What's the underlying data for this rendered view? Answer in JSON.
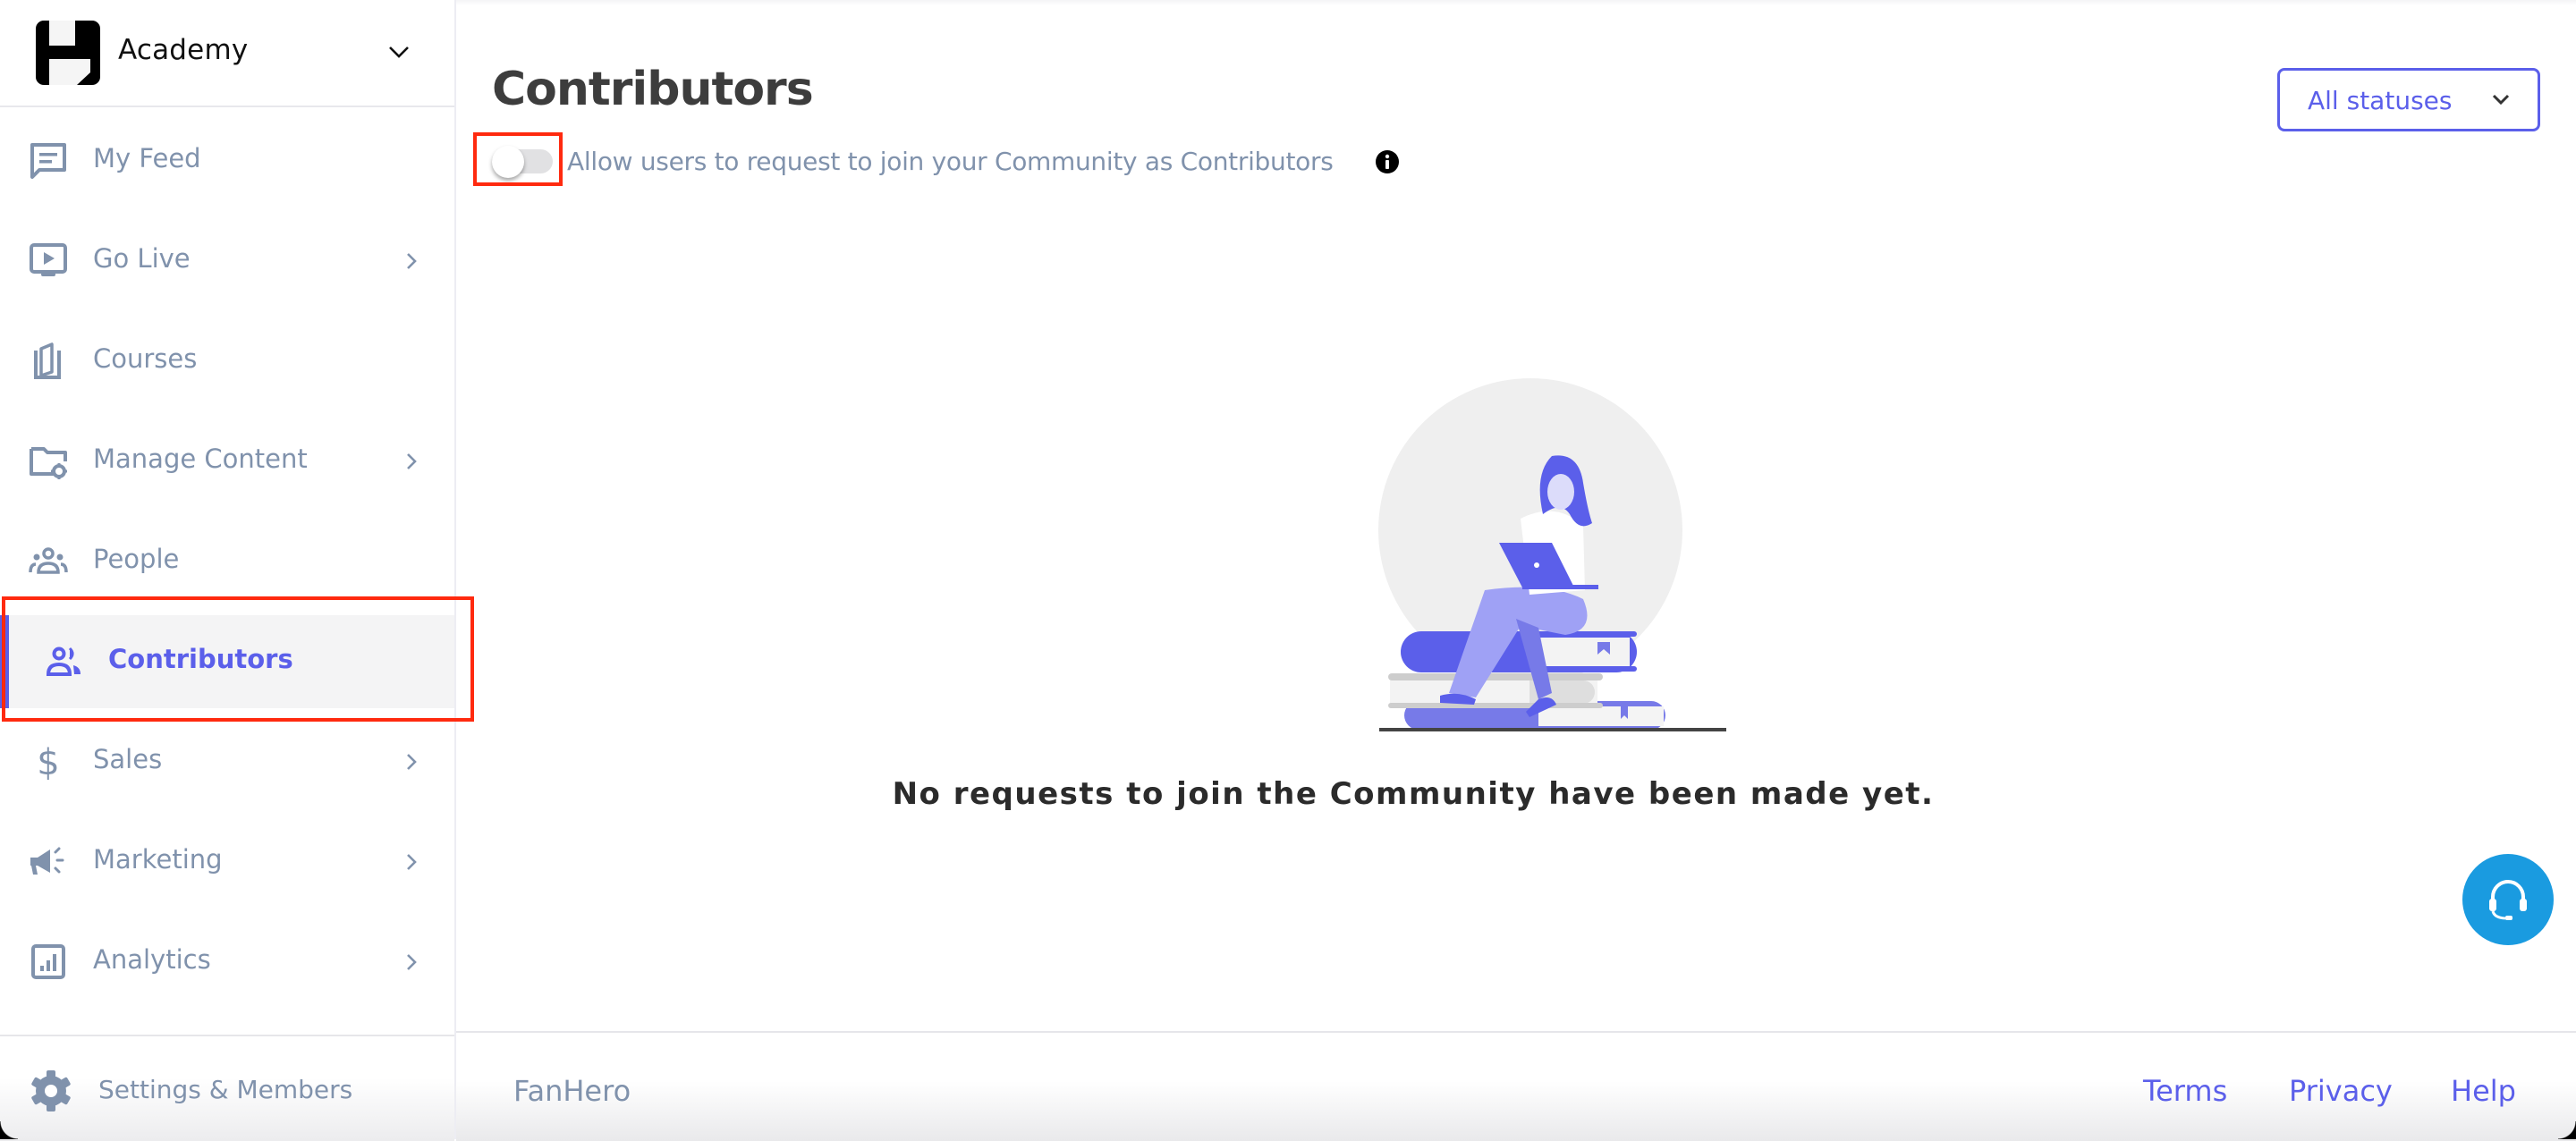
{
  "app": {
    "brand_name": "Academy",
    "logo": "fanhero-logo",
    "brand_dropdown_icon": "chevron-down-icon"
  },
  "sidebar": {
    "items": [
      {
        "label": "My Feed",
        "icon": "feed-icon",
        "has_submenu": false,
        "active": false
      },
      {
        "label": "Go Live",
        "icon": "live-video-icon",
        "has_submenu": true,
        "active": false
      },
      {
        "label": "Courses",
        "icon": "book-icon",
        "has_submenu": false,
        "active": false
      },
      {
        "label": "Manage Content",
        "icon": "folder-settings-icon",
        "has_submenu": true,
        "active": false
      },
      {
        "label": "People",
        "icon": "people-icon",
        "has_submenu": false,
        "active": false
      },
      {
        "label": "Contributors",
        "icon": "contributors-icon",
        "has_submenu": false,
        "active": true
      },
      {
        "label": "Sales",
        "icon": "dollar-icon",
        "has_submenu": true,
        "active": false
      },
      {
        "label": "Marketing",
        "icon": "megaphone-icon",
        "has_submenu": true,
        "active": false
      },
      {
        "label": "Analytics",
        "icon": "analytics-icon",
        "has_submenu": true,
        "active": false
      }
    ],
    "footer": {
      "label": "Settings & Members",
      "icon": "gear-icon"
    }
  },
  "main": {
    "title": "Contributors",
    "toggle": {
      "label": "Allow users to request to join your Community as Contributors",
      "enabled": false,
      "info_icon": "info-icon"
    },
    "status_filter": {
      "selected": "All statuses",
      "icon": "chevron-down-icon"
    },
    "empty_state": {
      "illustration": "woman-with-laptop-on-books-illustration",
      "message": "No requests to join the Community have been made yet."
    },
    "support_button": {
      "icon": "headset-icon"
    }
  },
  "footer": {
    "brand": "FanHero",
    "links": [
      "Terms",
      "Privacy",
      "Help"
    ]
  },
  "colors": {
    "accent": "#5b5fea",
    "nav_text": "#8092ac",
    "title": "#3d3d3d",
    "support": "#1a9be0",
    "annotation": "#ff2a0f",
    "active_bg": "#f4f4f5"
  }
}
